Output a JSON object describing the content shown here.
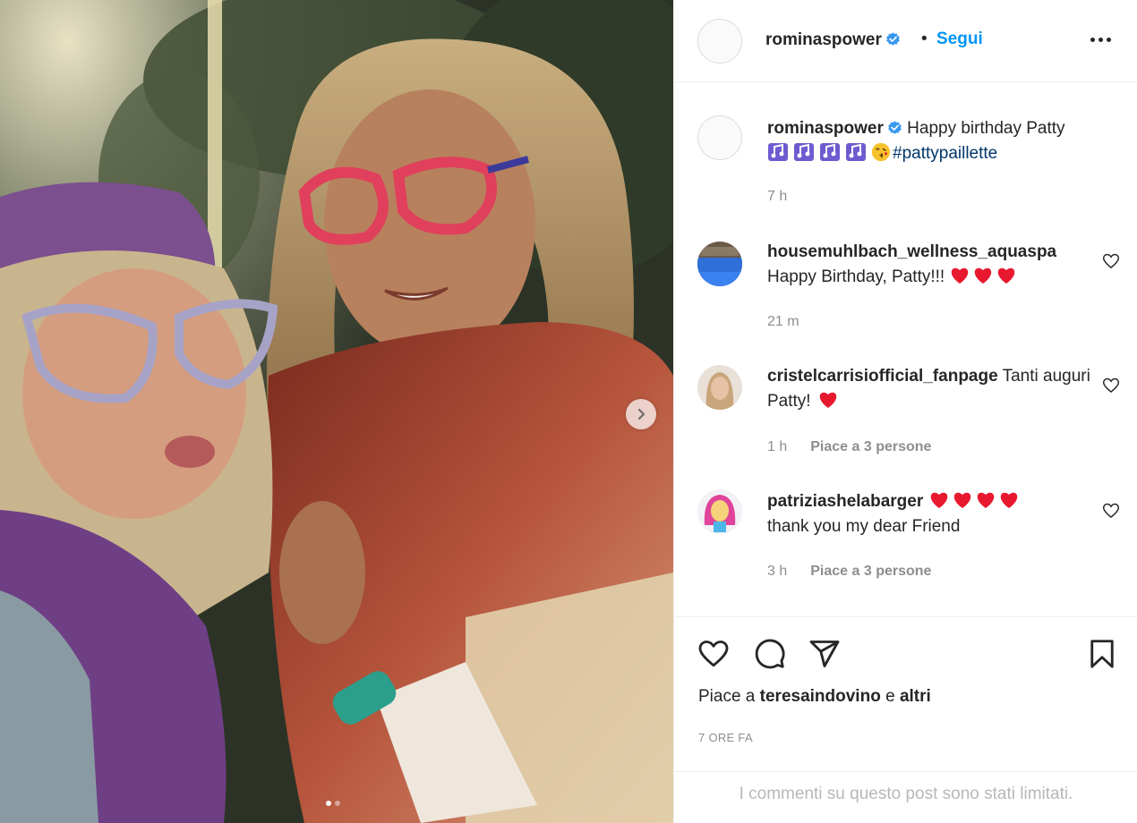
{
  "post": {
    "author": "rominaspower",
    "follow_label": "Segui",
    "separator": "•",
    "caption_user": "rominaspower",
    "caption_text": "Happy birthday Patty",
    "caption_hashtag": "#pattypaillette",
    "caption_time": "7 h",
    "likes_prefix": "Piace a",
    "likes_user": "teresaindovino",
    "likes_conj": "e",
    "likes_suffix": "altri",
    "timestamp": "7 ORE FA",
    "comments_limited": "I commenti su questo post sono stati limitati."
  },
  "carousel": {
    "current": 1,
    "total": 2
  },
  "comments": [
    {
      "user": "housemuhlbach_wellness_aquaspa",
      "text": "Happy Birthday, Patty!!!",
      "hearts": 3,
      "time": "21 m",
      "likes": ""
    },
    {
      "user": "cristelcarrisiofficial_fanpage",
      "text": "Tanti auguri Patty!",
      "hearts": 1,
      "time": "1 h",
      "likes": "Piace a 3 persone"
    },
    {
      "user": "patriziashelabarger",
      "text": "thank you my dear Friend",
      "hearts": 4,
      "time": "3 h",
      "likes": "Piace a 3 persone"
    }
  ],
  "colors": {
    "link_blue": "#0095f6",
    "hashtag": "#00376b",
    "heart_red": "#e8182f",
    "verified": "#3897f0"
  }
}
